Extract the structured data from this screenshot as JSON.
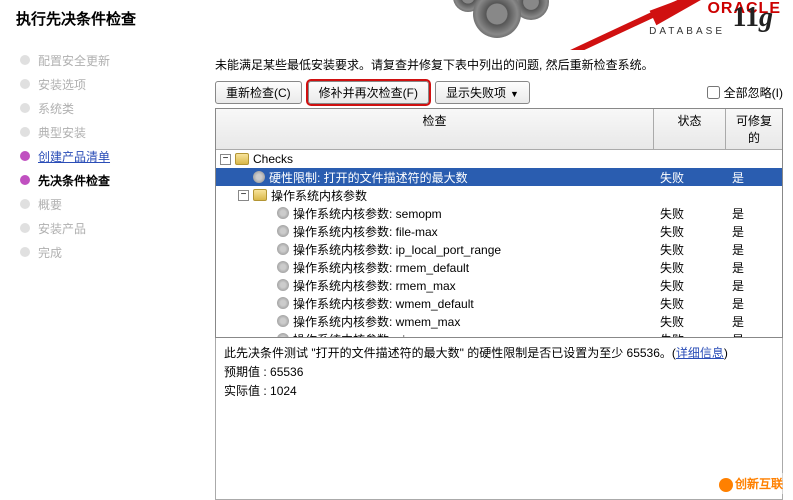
{
  "title": "执行先决条件检查",
  "logo": {
    "brand": "ORACLE",
    "product": "DATABASE",
    "version": "11",
    "suffix": "g"
  },
  "sidebar": {
    "items": [
      {
        "label": "配置安全更新",
        "active": false,
        "link": false,
        "current": false
      },
      {
        "label": "安装选项",
        "active": false,
        "link": false,
        "current": false
      },
      {
        "label": "系统类",
        "active": false,
        "link": false,
        "current": false
      },
      {
        "label": "典型安装",
        "active": false,
        "link": false,
        "current": false
      },
      {
        "label": "创建产品清单",
        "active": true,
        "link": true,
        "current": false
      },
      {
        "label": "先决条件检查",
        "active": true,
        "link": false,
        "current": true
      },
      {
        "label": "概要",
        "active": false,
        "link": false,
        "current": false
      },
      {
        "label": "安装产品",
        "active": false,
        "link": false,
        "current": false
      },
      {
        "label": "完成",
        "active": false,
        "link": false,
        "current": false
      }
    ]
  },
  "description": "未能满足某些最低安装要求。请复查并修复下表中列出的问题, 然后重新检查系统。",
  "toolbar": {
    "recheck": "重新检查(C)",
    "fix_recheck": "修补并再次检查(F)",
    "show_failed": "显示失败项",
    "ignore_all": "全部忽略(I)"
  },
  "table": {
    "headers": {
      "check": "检查",
      "status": "状态",
      "fixable": "可修复的"
    },
    "rows": [
      {
        "indent": 0,
        "toggle": "−",
        "icon": "folder",
        "label": "Checks",
        "status": "",
        "fixable": "",
        "selected": false
      },
      {
        "indent": 1,
        "toggle": "",
        "icon": "gear",
        "label": "硬性限制: 打开的文件描述符的最大数",
        "status": "失败",
        "fixable": "是",
        "selected": true
      },
      {
        "indent": 1,
        "toggle": "−",
        "icon": "folder",
        "label": "操作系统内核参数",
        "status": "",
        "fixable": "",
        "selected": false
      },
      {
        "indent": 2,
        "toggle": "",
        "icon": "gear",
        "label": "操作系统内核参数: semopm",
        "status": "失败",
        "fixable": "是",
        "selected": false
      },
      {
        "indent": 2,
        "toggle": "",
        "icon": "gear",
        "label": "操作系统内核参数: file-max",
        "status": "失败",
        "fixable": "是",
        "selected": false
      },
      {
        "indent": 2,
        "toggle": "",
        "icon": "gear",
        "label": "操作系统内核参数: ip_local_port_range",
        "status": "失败",
        "fixable": "是",
        "selected": false
      },
      {
        "indent": 2,
        "toggle": "",
        "icon": "gear",
        "label": "操作系统内核参数: rmem_default",
        "status": "失败",
        "fixable": "是",
        "selected": false
      },
      {
        "indent": 2,
        "toggle": "",
        "icon": "gear",
        "label": "操作系统内核参数: rmem_max",
        "status": "失败",
        "fixable": "是",
        "selected": false
      },
      {
        "indent": 2,
        "toggle": "",
        "icon": "gear",
        "label": "操作系统内核参数: wmem_default",
        "status": "失败",
        "fixable": "是",
        "selected": false
      },
      {
        "indent": 2,
        "toggle": "",
        "icon": "gear",
        "label": "操作系统内核参数: wmem_max",
        "status": "失败",
        "fixable": "是",
        "selected": false
      },
      {
        "indent": 2,
        "toggle": "",
        "icon": "gear",
        "label": "操作系统内核参数: aio-max-nr",
        "status": "失败",
        "fixable": "是",
        "selected": false
      }
    ]
  },
  "detail": {
    "desc_prefix": "此先决条件测试 \"打开的文件描述符的最大数\" 的硬性限制是否已设置为至少 65536。(",
    "more": "详细信息",
    "desc_suffix": ")",
    "expected_label": "预期值",
    "expected_value": ": 65536",
    "actual_label": "实际值",
    "actual_value": ": 1024"
  },
  "watermark": "创新互联"
}
